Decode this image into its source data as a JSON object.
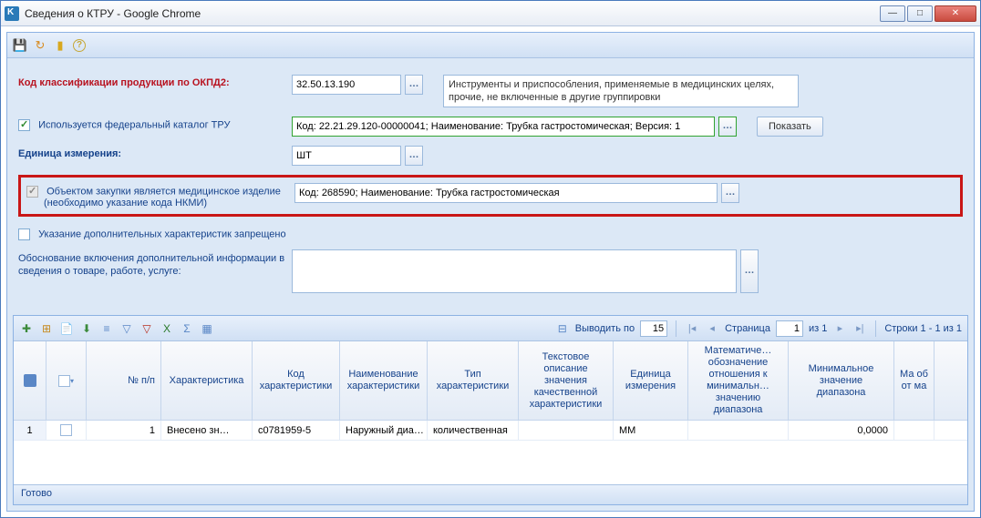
{
  "title": "Сведения о КТРУ - Google Chrome",
  "toolbar": {
    "save": "save",
    "refresh": "refresh",
    "key": "key",
    "help": "help"
  },
  "form": {
    "okpd2_label": "Код классификации продукции по ОКПД2:",
    "okpd2_value": "32.50.13.190",
    "okpd2_desc": "Инструменты и приспособления, применяемые в медицинских целях, прочие, не включенные в другие группировки",
    "fed_catalog_label": "Используется федеральный каталог ТРУ",
    "fed_catalog_value": "Код: 22.21.29.120-00000041; Наименование: Трубка гастростомическая; Версия: 1",
    "show_btn": "Показать",
    "unit_label": "Единица измерения:",
    "unit_value": "ШТ",
    "med_label_line1": "Объектом закупки является медицинское изделие",
    "med_label_line2": "(необходимо указание кода НКМИ)",
    "med_value": "Код: 268590; Наименование: Трубка гастростомическая",
    "extra_forbidden_label": "Указание дополнительных характеристик запрещено",
    "justification_label": "Обоснование включения дополнительной информации в сведения о товаре, работе, услуге:",
    "justification_value": ""
  },
  "grid": {
    "pager": {
      "output_label": "Выводить по",
      "output_value": "15",
      "page_label": "Страница",
      "page_value": "1",
      "page_of": "из 1",
      "rows_text": "Строки 1 - 1 из 1"
    },
    "columns": {
      "num": "№ п/п",
      "char": "Характеристика",
      "code": "Код характеристики",
      "name": "Наименование характеристики",
      "type": "Тип характеристики",
      "desc": "Текстовое описание значения качественной характеристики",
      "unit": "Единица измерения",
      "math": "Математиче… обозначение отношения к минимальн… значению диапазона",
      "min": "Минимальное значение диапазона",
      "max": "Ма об от ма"
    },
    "rows": [
      {
        "idx": "1",
        "num": "1",
        "char": "Внесено зн…",
        "code": "c0781959-5",
        "name": "Наружный диа…",
        "type": "количественная",
        "desc": "",
        "unit": "ММ",
        "math": "",
        "min": "0,0000",
        "max": ""
      }
    ],
    "status": "Готово"
  }
}
